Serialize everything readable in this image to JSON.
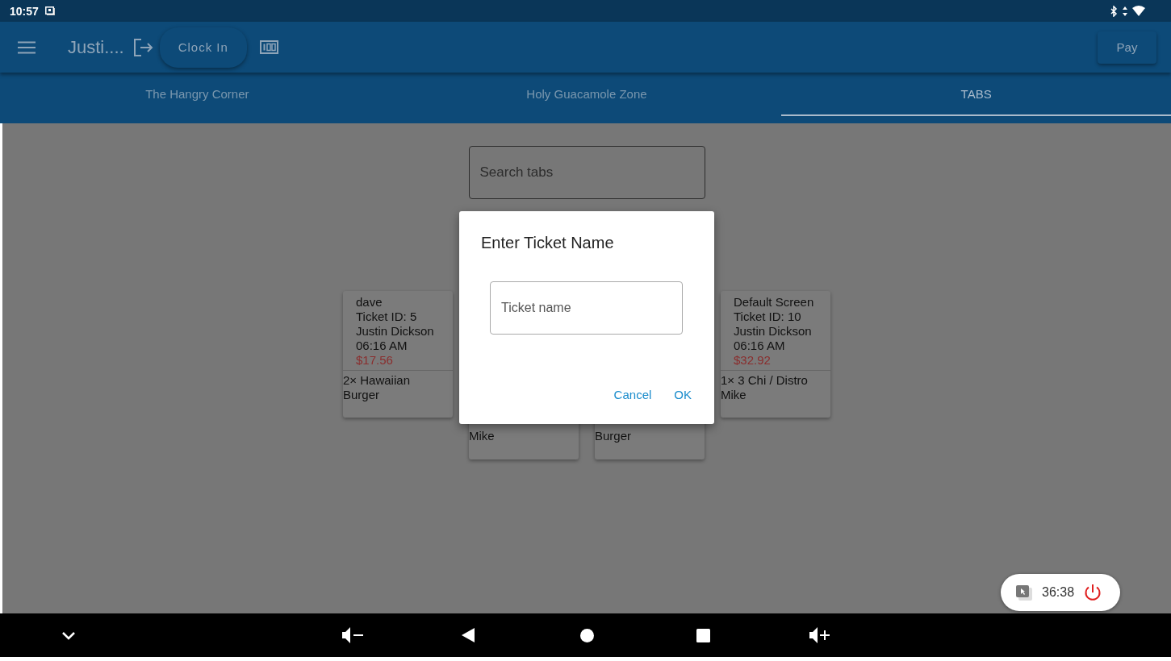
{
  "status_bar": {
    "time": "10:57"
  },
  "app_bar": {
    "title": "Justi....",
    "clock_in": "Clock In",
    "pay": "Pay"
  },
  "tabs": [
    {
      "label": "The Hangry Corner",
      "selected": false
    },
    {
      "label": "Holy Guacamole Zone",
      "selected": false
    },
    {
      "label": "TABS",
      "selected": true
    }
  ],
  "search": {
    "placeholder": "Search tabs"
  },
  "tickets": [
    {
      "kind": "full",
      "name": "dave",
      "ticket_id": "Ticket ID: 5",
      "server": "Justin Dickson",
      "time": "06:16 AM",
      "total": "$17.56",
      "items": "2× Hawaiian Burger"
    },
    {
      "kind": "partial",
      "visible_text": "Mike"
    },
    {
      "kind": "partial",
      "visible_text": "Burger"
    },
    {
      "kind": "full",
      "name": "Default Screen",
      "ticket_id": "Ticket ID: 10",
      "server": "Justin Dickson",
      "time": "06:16 AM",
      "total": "$32.92",
      "items": "1× 3 Chi / Distro Mike"
    }
  ],
  "dialog": {
    "title": "Enter Ticket Name",
    "field": {
      "placeholder": "Ticket name"
    },
    "buttons": [
      "Cancel",
      "OK"
    ]
  },
  "recording_pill": {
    "time": "36:38"
  }
}
